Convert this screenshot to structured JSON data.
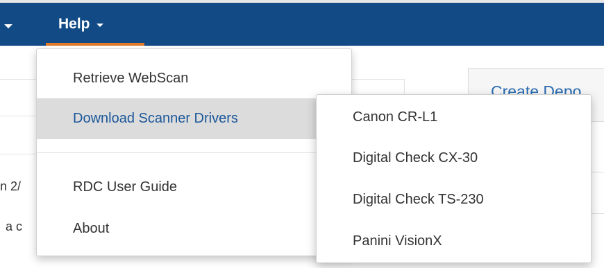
{
  "navbar": {
    "help_label": "Help",
    "colors": {
      "background": "#124a86",
      "active_underline": "#e07b2a"
    }
  },
  "background": {
    "panel_title": "Create Depo",
    "text_line1": "n 2/",
    "text_line2": "a c"
  },
  "help_menu": {
    "items": [
      {
        "label": "Retrieve WebScan"
      },
      {
        "label": "Download Scanner Drivers",
        "active": true
      },
      {
        "label": "RDC User Guide"
      },
      {
        "label": "About"
      }
    ]
  },
  "scanner_drivers_submenu": {
    "items": [
      {
        "label": "Canon CR-L1"
      },
      {
        "label": "Digital Check CX-30"
      },
      {
        "label": "Digital Check TS-230"
      },
      {
        "label": "Panini VisionX"
      }
    ]
  }
}
